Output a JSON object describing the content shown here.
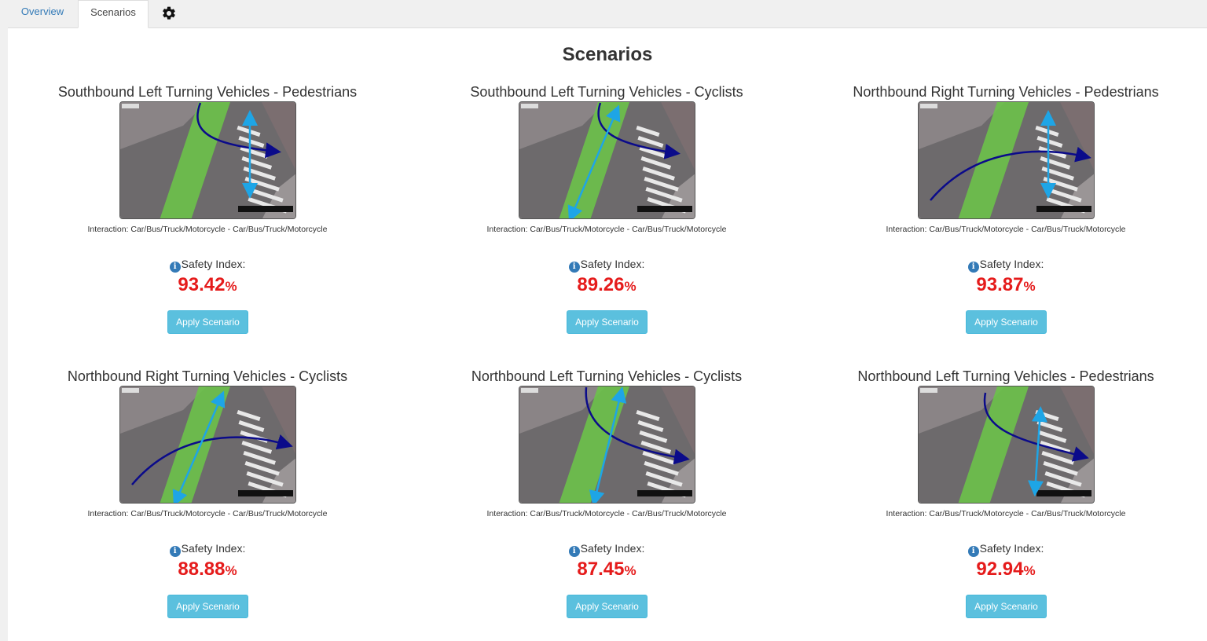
{
  "tabs": [
    {
      "label": "Overview"
    },
    {
      "label": "Scenarios"
    }
  ],
  "settings_icon": "gear-icon",
  "page_title": "Scenarios",
  "colors": {
    "link": "#337ab7",
    "safety_value": "#e51b1b",
    "button_bg": "#5bc0de",
    "info_icon": "#337ab7"
  },
  "scenarios": [
    {
      "title": "Southbound Left Turning Vehicles - Pedestrians",
      "interaction": "Interaction: Car/Bus/Truck/Motorcycle - Car/Bus/Truck/Motorcycle",
      "safety_label": "Safety Index:",
      "safety_value": "93.42",
      "unit": "%",
      "button": "Apply Scenario"
    },
    {
      "title": "Southbound Left Turning Vehicles - Cyclists",
      "interaction": "Interaction: Car/Bus/Truck/Motorcycle - Car/Bus/Truck/Motorcycle",
      "safety_label": "Safety Index:",
      "safety_value": "89.26",
      "unit": "%",
      "button": "Apply Scenario"
    },
    {
      "title": "Northbound Right Turning Vehicles - Pedestrians",
      "interaction": "Interaction: Car/Bus/Truck/Motorcycle - Car/Bus/Truck/Motorcycle",
      "safety_label": "Safety Index:",
      "safety_value": "93.87",
      "unit": "%",
      "button": "Apply Scenario"
    },
    {
      "title": "Northbound Right Turning Vehicles - Cyclists",
      "interaction": "Interaction: Car/Bus/Truck/Motorcycle - Car/Bus/Truck/Motorcycle",
      "safety_label": "Safety Index:",
      "safety_value": "88.88",
      "unit": "%",
      "button": "Apply Scenario"
    },
    {
      "title": "Northbound Left Turning Vehicles - Cyclists",
      "interaction": "Interaction: Car/Bus/Truck/Motorcycle - Car/Bus/Truck/Motorcycle",
      "safety_label": "Safety Index:",
      "safety_value": "87.45",
      "unit": "%",
      "button": "Apply Scenario"
    },
    {
      "title": "Northbound Left Turning Vehicles - Pedestrians",
      "interaction": "Interaction: Car/Bus/Truck/Motorcycle - Car/Bus/Truck/Motorcycle",
      "safety_label": "Safety Index:",
      "safety_value": "92.94",
      "unit": "%",
      "button": "Apply Scenario"
    }
  ]
}
